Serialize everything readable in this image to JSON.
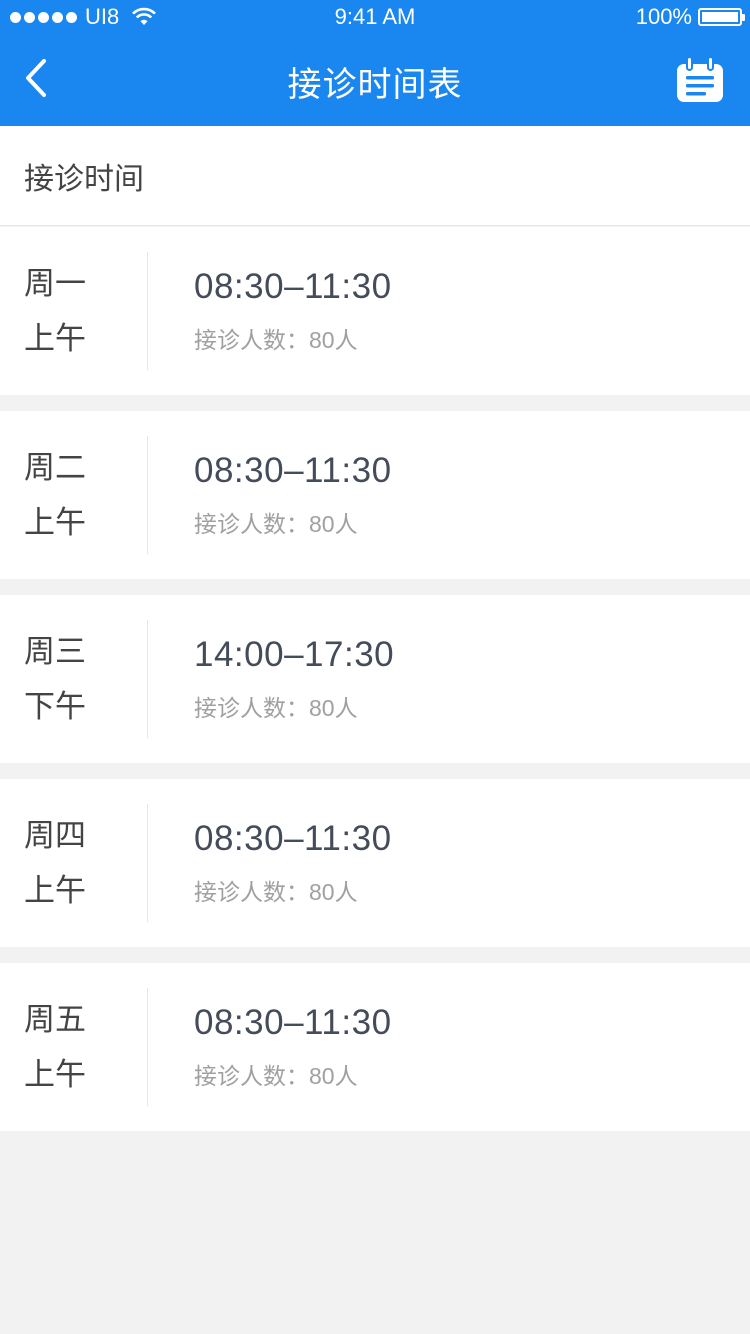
{
  "status_bar": {
    "carrier": "UI8",
    "time": "9:41 AM",
    "battery": "100%"
  },
  "nav": {
    "title": "接诊时间表",
    "back_icon": "chevron-left-icon",
    "calendar_icon": "calendar-icon"
  },
  "section": {
    "title": "接诊时间"
  },
  "schedule": [
    {
      "day": "周一",
      "period": "上午",
      "time": "08:30–11:30",
      "capacity_label": "接诊人数：",
      "capacity": "80人"
    },
    {
      "day": "周二",
      "period": "上午",
      "time": "08:30–11:30",
      "capacity_label": "接诊人数：",
      "capacity": "80人"
    },
    {
      "day": "周三",
      "period": "下午",
      "time": "14:00–17:30",
      "capacity_label": "接诊人数：",
      "capacity": "80人"
    },
    {
      "day": "周四",
      "period": "上午",
      "time": "08:30–11:30",
      "capacity_label": "接诊人数：",
      "capacity": "80人"
    },
    {
      "day": "周五",
      "period": "上午",
      "time": "08:30–11:30",
      "capacity_label": "接诊人数：",
      "capacity": "80人"
    }
  ],
  "colors": {
    "accent": "#1a86f0",
    "background": "#f2f2f2"
  }
}
